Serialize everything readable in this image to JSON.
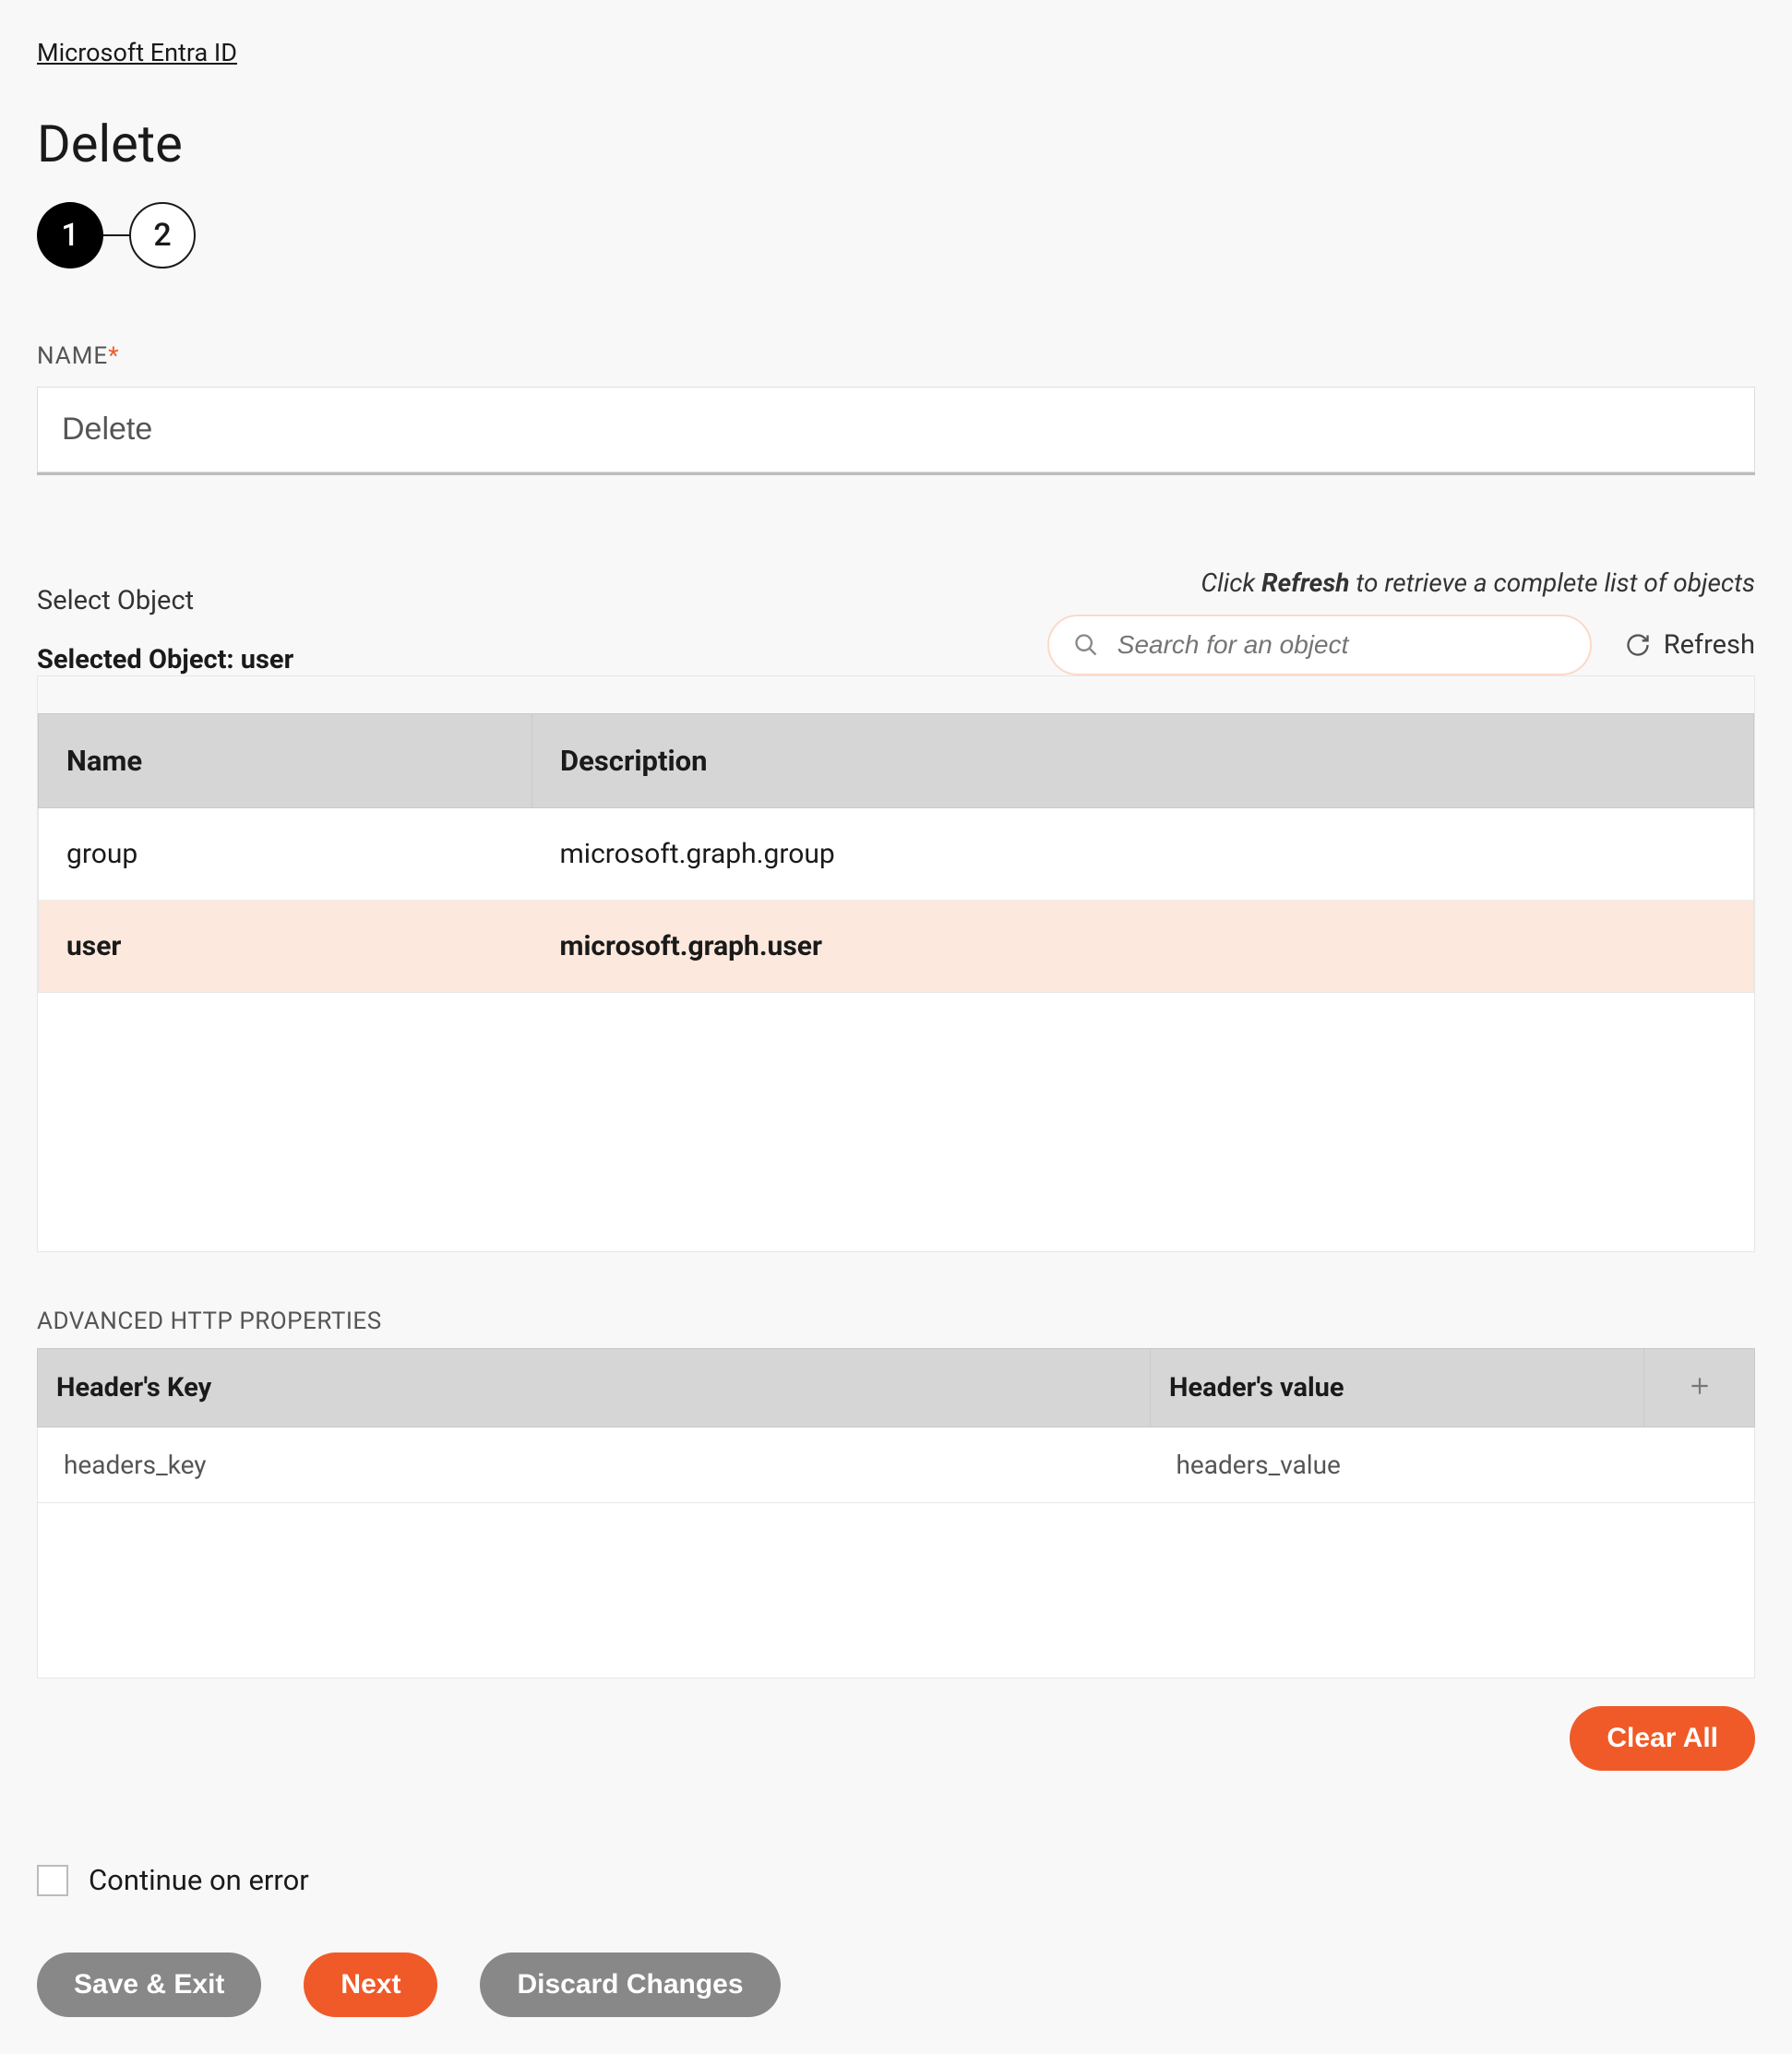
{
  "breadcrumb": "Microsoft Entra ID",
  "page_title": "Delete",
  "stepper": {
    "step1": "1",
    "step2": "2"
  },
  "name_field": {
    "label": "NAME",
    "value": "Delete"
  },
  "select_object": {
    "label": "Select Object",
    "hint_prefix": "Click ",
    "hint_bold": "Refresh",
    "hint_suffix": " to retrieve a complete list of objects",
    "selected_prefix": "Selected Object: ",
    "selected_value": "user",
    "search_placeholder": "Search for an object",
    "refresh_label": "Refresh"
  },
  "object_table": {
    "col_name": "Name",
    "col_desc": "Description",
    "rows": [
      {
        "name": "group",
        "desc": "microsoft.graph.group",
        "selected": false
      },
      {
        "name": "user",
        "desc": "microsoft.graph.user",
        "selected": true
      }
    ]
  },
  "advanced_http": {
    "label": "ADVANCED HTTP PROPERTIES",
    "col_key": "Header's Key",
    "col_val": "Header's value",
    "rows": [
      {
        "key": "headers_key",
        "val": "headers_value"
      }
    ]
  },
  "clear_all": "Clear All",
  "continue_on_error": "Continue on error",
  "footer": {
    "save_exit": "Save & Exit",
    "next": "Next",
    "discard": "Discard Changes"
  }
}
